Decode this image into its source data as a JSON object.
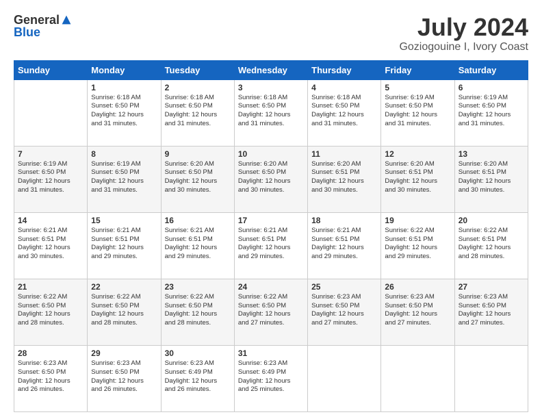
{
  "logo": {
    "general": "General",
    "blue": "Blue"
  },
  "header": {
    "month": "July 2024",
    "location": "Goziogouine I, Ivory Coast"
  },
  "weekdays": [
    "Sunday",
    "Monday",
    "Tuesday",
    "Wednesday",
    "Thursday",
    "Friday",
    "Saturday"
  ],
  "weeks": [
    [
      {
        "date": "",
        "text": ""
      },
      {
        "date": "1",
        "text": "Sunrise: 6:18 AM\nSunset: 6:50 PM\nDaylight: 12 hours\nand 31 minutes."
      },
      {
        "date": "2",
        "text": "Sunrise: 6:18 AM\nSunset: 6:50 PM\nDaylight: 12 hours\nand 31 minutes."
      },
      {
        "date": "3",
        "text": "Sunrise: 6:18 AM\nSunset: 6:50 PM\nDaylight: 12 hours\nand 31 minutes."
      },
      {
        "date": "4",
        "text": "Sunrise: 6:18 AM\nSunset: 6:50 PM\nDaylight: 12 hours\nand 31 minutes."
      },
      {
        "date": "5",
        "text": "Sunrise: 6:19 AM\nSunset: 6:50 PM\nDaylight: 12 hours\nand 31 minutes."
      },
      {
        "date": "6",
        "text": "Sunrise: 6:19 AM\nSunset: 6:50 PM\nDaylight: 12 hours\nand 31 minutes."
      }
    ],
    [
      {
        "date": "7",
        "text": "Sunrise: 6:19 AM\nSunset: 6:50 PM\nDaylight: 12 hours\nand 31 minutes."
      },
      {
        "date": "8",
        "text": "Sunrise: 6:19 AM\nSunset: 6:50 PM\nDaylight: 12 hours\nand 31 minutes."
      },
      {
        "date": "9",
        "text": "Sunrise: 6:20 AM\nSunset: 6:50 PM\nDaylight: 12 hours\nand 30 minutes."
      },
      {
        "date": "10",
        "text": "Sunrise: 6:20 AM\nSunset: 6:50 PM\nDaylight: 12 hours\nand 30 minutes."
      },
      {
        "date": "11",
        "text": "Sunrise: 6:20 AM\nSunset: 6:51 PM\nDaylight: 12 hours\nand 30 minutes."
      },
      {
        "date": "12",
        "text": "Sunrise: 6:20 AM\nSunset: 6:51 PM\nDaylight: 12 hours\nand 30 minutes."
      },
      {
        "date": "13",
        "text": "Sunrise: 6:20 AM\nSunset: 6:51 PM\nDaylight: 12 hours\nand 30 minutes."
      }
    ],
    [
      {
        "date": "14",
        "text": "Sunrise: 6:21 AM\nSunset: 6:51 PM\nDaylight: 12 hours\nand 30 minutes."
      },
      {
        "date": "15",
        "text": "Sunrise: 6:21 AM\nSunset: 6:51 PM\nDaylight: 12 hours\nand 29 minutes."
      },
      {
        "date": "16",
        "text": "Sunrise: 6:21 AM\nSunset: 6:51 PM\nDaylight: 12 hours\nand 29 minutes."
      },
      {
        "date": "17",
        "text": "Sunrise: 6:21 AM\nSunset: 6:51 PM\nDaylight: 12 hours\nand 29 minutes."
      },
      {
        "date": "18",
        "text": "Sunrise: 6:21 AM\nSunset: 6:51 PM\nDaylight: 12 hours\nand 29 minutes."
      },
      {
        "date": "19",
        "text": "Sunrise: 6:22 AM\nSunset: 6:51 PM\nDaylight: 12 hours\nand 29 minutes."
      },
      {
        "date": "20",
        "text": "Sunrise: 6:22 AM\nSunset: 6:51 PM\nDaylight: 12 hours\nand 28 minutes."
      }
    ],
    [
      {
        "date": "21",
        "text": "Sunrise: 6:22 AM\nSunset: 6:50 PM\nDaylight: 12 hours\nand 28 minutes."
      },
      {
        "date": "22",
        "text": "Sunrise: 6:22 AM\nSunset: 6:50 PM\nDaylight: 12 hours\nand 28 minutes."
      },
      {
        "date": "23",
        "text": "Sunrise: 6:22 AM\nSunset: 6:50 PM\nDaylight: 12 hours\nand 28 minutes."
      },
      {
        "date": "24",
        "text": "Sunrise: 6:22 AM\nSunset: 6:50 PM\nDaylight: 12 hours\nand 27 minutes."
      },
      {
        "date": "25",
        "text": "Sunrise: 6:23 AM\nSunset: 6:50 PM\nDaylight: 12 hours\nand 27 minutes."
      },
      {
        "date": "26",
        "text": "Sunrise: 6:23 AM\nSunset: 6:50 PM\nDaylight: 12 hours\nand 27 minutes."
      },
      {
        "date": "27",
        "text": "Sunrise: 6:23 AM\nSunset: 6:50 PM\nDaylight: 12 hours\nand 27 minutes."
      }
    ],
    [
      {
        "date": "28",
        "text": "Sunrise: 6:23 AM\nSunset: 6:50 PM\nDaylight: 12 hours\nand 26 minutes."
      },
      {
        "date": "29",
        "text": "Sunrise: 6:23 AM\nSunset: 6:50 PM\nDaylight: 12 hours\nand 26 minutes."
      },
      {
        "date": "30",
        "text": "Sunrise: 6:23 AM\nSunset: 6:49 PM\nDaylight: 12 hours\nand 26 minutes."
      },
      {
        "date": "31",
        "text": "Sunrise: 6:23 AM\nSunset: 6:49 PM\nDaylight: 12 hours\nand 25 minutes."
      },
      {
        "date": "",
        "text": ""
      },
      {
        "date": "",
        "text": ""
      },
      {
        "date": "",
        "text": ""
      }
    ]
  ]
}
